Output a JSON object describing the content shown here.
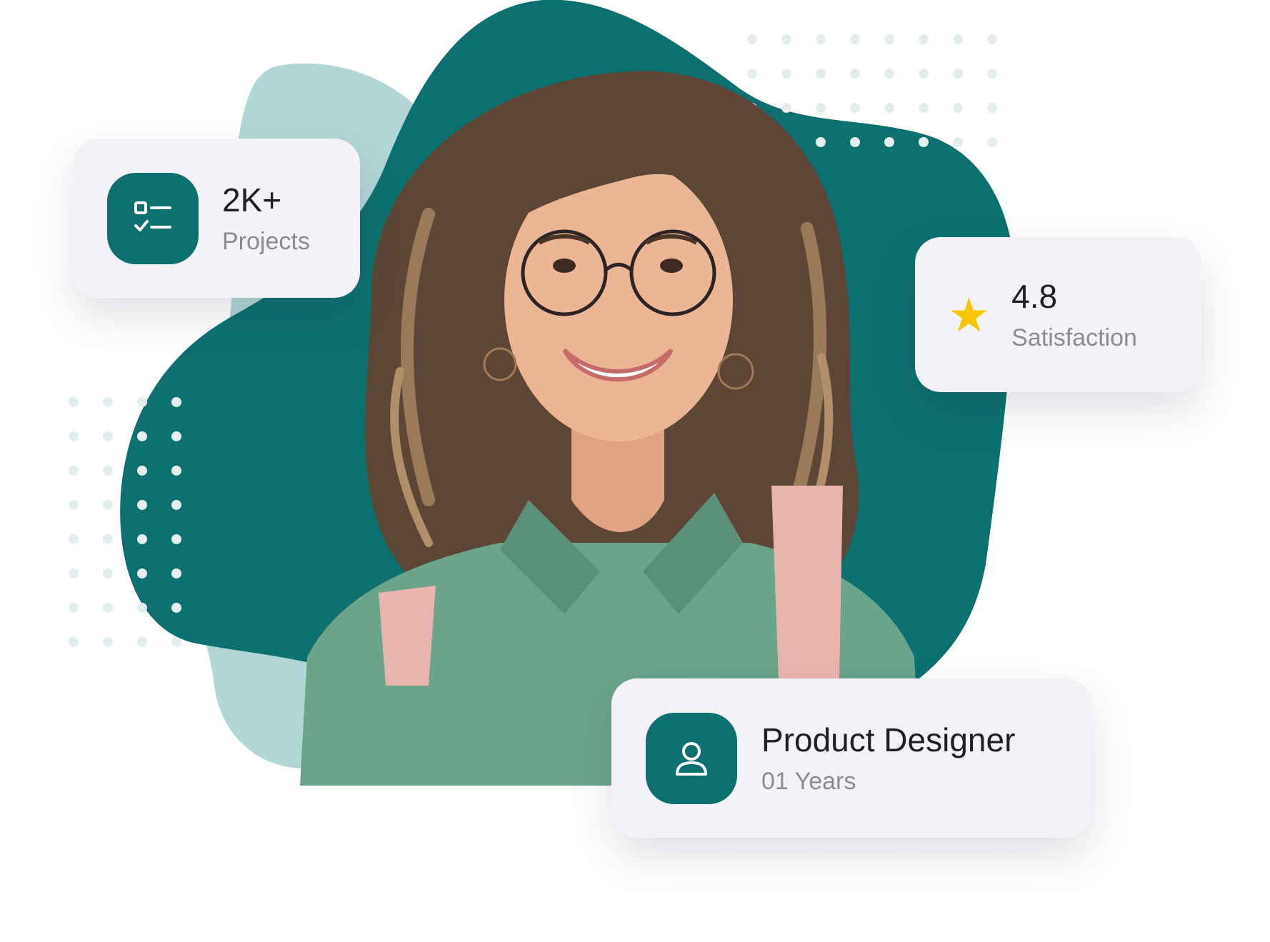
{
  "colors": {
    "blob_dark": "#0c7070",
    "blob_light": "#b2d6d6",
    "dots": "#e4eeee",
    "card_bg": "#f3f3f7",
    "icon_tile": "#0c7070",
    "star": "#f7c600",
    "value_text": "#1e1e24",
    "label_text": "#8b8b93"
  },
  "projects_card": {
    "icon": "checklist-icon",
    "value": "2K+",
    "label": "Projects"
  },
  "rating_card": {
    "icon": "star-icon",
    "value": "4.8",
    "label": "Satisfaction"
  },
  "role_card": {
    "icon": "user-icon",
    "value": "Product Designer",
    "label": "01 Years"
  }
}
